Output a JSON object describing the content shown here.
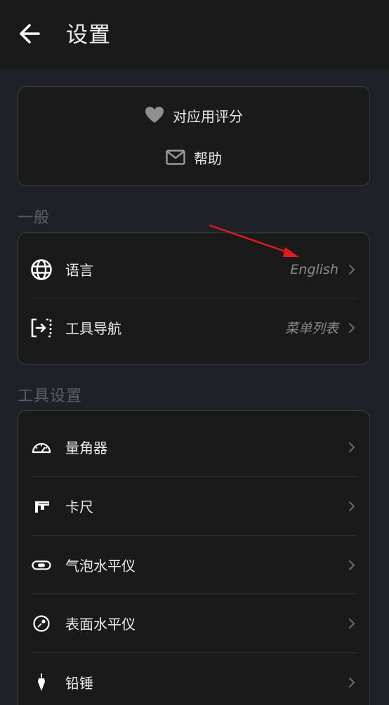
{
  "header": {
    "title": "设置",
    "back_icon": "arrow-left-icon"
  },
  "top_card": {
    "rate_label": "对应用评分",
    "rate_icon": "heart-icon",
    "help_label": "帮助",
    "help_icon": "mail-icon"
  },
  "general": {
    "section_title": "一般",
    "items": [
      {
        "label": "语言",
        "value": "English",
        "icon": "globe-icon"
      },
      {
        "label": "工具导航",
        "value": "菜单列表",
        "icon": "navigation-icon"
      }
    ]
  },
  "tools": {
    "section_title": "工具设置",
    "items": [
      {
        "label": "量角器",
        "icon": "protractor-icon"
      },
      {
        "label": "卡尺",
        "icon": "caliper-icon"
      },
      {
        "label": "气泡水平仪",
        "icon": "bubble-level-icon"
      },
      {
        "label": "表面水平仪",
        "icon": "surface-level-icon"
      },
      {
        "label": "铅锤",
        "icon": "plumb-bob-icon"
      }
    ]
  },
  "colors": {
    "background": "#1f2129",
    "card": "#1a1a1a",
    "appbar": "#1a1a1a",
    "section_title": "#5c5e66",
    "value_text": "#8a8a8a",
    "annotation_arrow": "#e01b1b"
  }
}
